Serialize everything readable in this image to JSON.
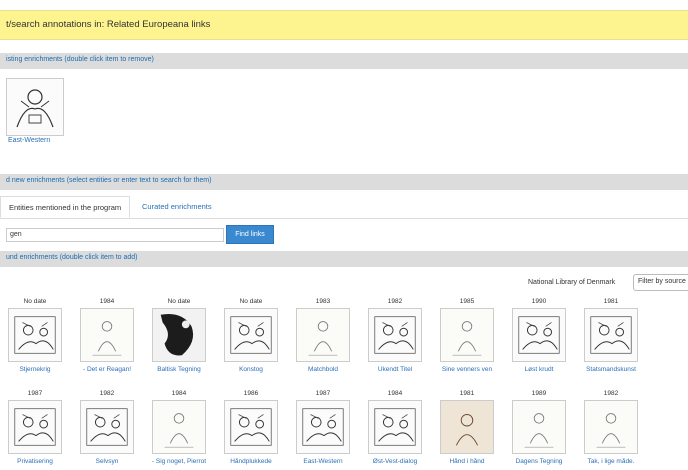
{
  "header": {
    "title": "t/search annotations in: Related Europeana links"
  },
  "existing": {
    "section_label": "isting enrichments (double click item to remove)",
    "items": [
      {
        "title": "East-Western"
      }
    ]
  },
  "add": {
    "section_label": "d new enrichments (select entities or enter text to search for them)"
  },
  "tabs": [
    {
      "label": "Entities mentioned in the program"
    },
    {
      "label": "Curated enrichments"
    }
  ],
  "search": {
    "value": "gen",
    "button_label": "Find links"
  },
  "found": {
    "section_label": "und enrichments (double click item to add)",
    "filter_label": "National Library of Denmark",
    "filter_select": "Filter by source",
    "row1": [
      {
        "year": "No date",
        "title": "Stjernekrig",
        "thumb": "sketch"
      },
      {
        "year": "1984",
        "title": "- Det er Reagan!",
        "thumb": "light"
      },
      {
        "year": "No date",
        "title": "Baltisk Tegning",
        "thumb": "dark"
      },
      {
        "year": "No date",
        "title": "Konstog",
        "thumb": "sketch"
      },
      {
        "year": "1983",
        "title": "Matchbold",
        "thumb": "light"
      },
      {
        "year": "1982",
        "title": "Ukendt Titel",
        "thumb": "sketch"
      },
      {
        "year": "1985",
        "title": "Sine venners ven",
        "thumb": "light"
      },
      {
        "year": "1990",
        "title": "Løst krudt",
        "thumb": "sketch"
      },
      {
        "year": "1981",
        "title": "Statsmandskunst",
        "thumb": "sketch"
      }
    ],
    "row2": [
      {
        "year": "1987",
        "title": "Privatisering",
        "thumb": "sketch"
      },
      {
        "year": "1982",
        "title": "Selvsyn",
        "thumb": "sketch"
      },
      {
        "year": "1984",
        "title": "- Sig noget, Pierrot",
        "thumb": "light"
      },
      {
        "year": "1986",
        "title": "Håndplukkede",
        "thumb": "sketch"
      },
      {
        "year": "1987",
        "title": "East-Western",
        "thumb": "sketch"
      },
      {
        "year": "1984",
        "title": "Øst-Vest-dialog",
        "thumb": "sketch"
      },
      {
        "year": "1981",
        "title": "Hånd i hånd",
        "thumb": "tan"
      },
      {
        "year": "1989",
        "title": "Dagens Tegning",
        "thumb": "light"
      },
      {
        "year": "1982",
        "title": "Tak, i lige måde.",
        "thumb": "light"
      }
    ]
  }
}
